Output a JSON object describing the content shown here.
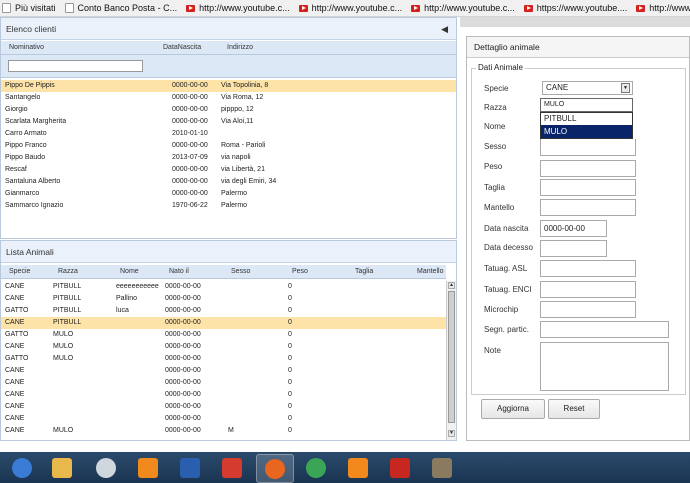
{
  "bookmarks": [
    {
      "label": "Più visitati",
      "icon": "page-icon"
    },
    {
      "label": "Conto Banco Posta - C...",
      "icon": "page-icon"
    },
    {
      "label": "http://www.youtube.c...",
      "icon": "youtube-icon"
    },
    {
      "label": "http://www.youtube.c...",
      "icon": "youtube-icon"
    },
    {
      "label": "http://www.youtube.c...",
      "icon": "youtube-icon"
    },
    {
      "label": "https://www.youtube....",
      "icon": "youtube-icon"
    },
    {
      "label": "http://www.yo",
      "icon": "youtube-icon"
    }
  ],
  "clients": {
    "title": "Elenco clienti",
    "columns": [
      "Nominativo",
      "DataNascita",
      "Indirizzo"
    ],
    "filter_value": "",
    "rows": [
      {
        "name": "Pippo De Pippis",
        "date": "0000-00-00",
        "address": "Via Topolinia, 8",
        "selected": true
      },
      {
        "name": "Santangelo",
        "date": "0000-00-00",
        "address": "Via Roma, 12"
      },
      {
        "name": "Giorgio",
        "date": "0000-00-00",
        "address": "pipppo, 12"
      },
      {
        "name": "Scarlata Margherita",
        "date": "0000-00-00",
        "address": "Via Aloi,11"
      },
      {
        "name": "Carro Armato",
        "date": "2010-01-10",
        "address": ""
      },
      {
        "name": "Pippo Franco",
        "date": "0000-00-00",
        "address": "Roma - Parioli"
      },
      {
        "name": "Pippo Baudo",
        "date": "2013-07-09",
        "address": "via napoli"
      },
      {
        "name": "Rescaf",
        "date": "0000-00-00",
        "address": "via Libertà, 21"
      },
      {
        "name": "Santaluna Alberto",
        "date": "0000-00-00",
        "address": "via degli Emiri, 34"
      },
      {
        "name": "Gianmarco",
        "date": "0000-00-00",
        "address": "Palermo"
      },
      {
        "name": "Sammarco Ignazio",
        "date": "1970-06-22",
        "address": "Palermo"
      }
    ]
  },
  "animals": {
    "title": "Lista Animali",
    "columns": [
      "Specie",
      "Razza",
      "Nome",
      "Nato il",
      "Sesso",
      "Peso",
      "Taglia",
      "Mantello"
    ],
    "rows": [
      {
        "specie": "CANE",
        "razza": "PITBULL",
        "nome": "eeeeeeeeeee",
        "nato": "0000-00-00",
        "sesso": "",
        "peso": "0"
      },
      {
        "specie": "CANE",
        "razza": "PITBULL",
        "nome": "Pallino",
        "nato": "0000-00-00",
        "sesso": "",
        "peso": "0"
      },
      {
        "specie": "GATTO",
        "razza": "PITBULL",
        "nome": "luca",
        "nato": "0000-00-00",
        "sesso": "",
        "peso": "0"
      },
      {
        "specie": "CANE",
        "razza": "PITBULL",
        "nome": "",
        "nato": "0000-00-00",
        "sesso": "",
        "peso": "0",
        "selected": true
      },
      {
        "specie": "GATTO",
        "razza": "MULO",
        "nome": "",
        "nato": "0000-00-00",
        "sesso": "",
        "peso": "0"
      },
      {
        "specie": "CANE",
        "razza": "MULO",
        "nome": "",
        "nato": "0000-00-00",
        "sesso": "",
        "peso": "0"
      },
      {
        "specie": "GATTO",
        "razza": "MULO",
        "nome": "",
        "nato": "0000-00-00",
        "sesso": "",
        "peso": "0"
      },
      {
        "specie": "CANE",
        "razza": "",
        "nome": "",
        "nato": "0000-00-00",
        "sesso": "",
        "peso": "0"
      },
      {
        "specie": "CANE",
        "razza": "",
        "nome": "",
        "nato": "0000-00-00",
        "sesso": "",
        "peso": "0"
      },
      {
        "specie": "CANE",
        "razza": "",
        "nome": "",
        "nato": "0000-00-00",
        "sesso": "",
        "peso": "0"
      },
      {
        "specie": "CANE",
        "razza": "",
        "nome": "",
        "nato": "0000-00-00",
        "sesso": "",
        "peso": "0"
      },
      {
        "specie": "CANE",
        "razza": "",
        "nome": "",
        "nato": "0000-00-00",
        "sesso": "",
        "peso": "0"
      },
      {
        "specie": "CANE",
        "razza": "MULO",
        "nome": "",
        "nato": "0000-00-00",
        "sesso": "M",
        "peso": "0"
      }
    ]
  },
  "detail": {
    "title": "Dettaglio animale",
    "section": "Dati Animale",
    "labels": {
      "specie": "Specie",
      "razza": "Razza",
      "nome": "Nome",
      "sesso": "Sesso",
      "peso": "Peso",
      "taglia": "Taglia",
      "mantello": "Mantello",
      "data_nascita": "Data nascita",
      "data_decesso": "Data decesso",
      "tatuag_asl": "Tatuag. ASL",
      "tatuag_enci": "Tatuag. ENCI",
      "microchip": "Microchip",
      "segn_partic": "Segn. partic.",
      "note": "Note"
    },
    "values": {
      "specie": "CANE",
      "razza": "MULO",
      "data_nascita": "0000-00-00"
    },
    "razza_options": [
      "PITBULL",
      "MULO"
    ],
    "razza_selected": "MULO",
    "buttons": {
      "aggiorna": "Aggiorna",
      "reset": "Reset"
    }
  },
  "taskbar": {
    "apps": [
      {
        "name": "start-button-icon",
        "color": "#3a7bd5"
      },
      {
        "name": "explorer-icon",
        "color": "#e8b84a"
      },
      {
        "name": "app-circle-icon",
        "color": "#cfd6de"
      },
      {
        "name": "media-player-icon",
        "color": "#f08a1c"
      },
      {
        "name": "user-icon",
        "color": "#2a5fb0"
      },
      {
        "name": "pin-icon",
        "color": "#d63b2f"
      },
      {
        "name": "firefox-icon",
        "color": "#e8661e"
      },
      {
        "name": "chrome-icon",
        "color": "#3aa655"
      },
      {
        "name": "vlc-icon",
        "color": "#f2891c"
      },
      {
        "name": "filezilla-icon",
        "color": "#c6281f"
      },
      {
        "name": "gimp-icon",
        "color": "#8a7a60"
      }
    ]
  }
}
